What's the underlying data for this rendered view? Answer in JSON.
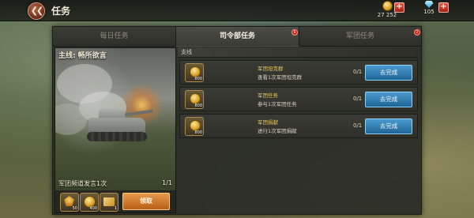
{
  "header": {
    "back_icon": "double-chevron-left-icon",
    "title": "任务",
    "gold": "27 252",
    "gems": "105"
  },
  "tabs": [
    {
      "label": "每日任务",
      "active": false,
      "badge": ""
    },
    {
      "label": "司令部任务",
      "active": true,
      "badge": "1"
    },
    {
      "label": "军团任务",
      "active": false,
      "badge": "2"
    }
  ],
  "mission": {
    "title": "主线: 畅所欲言",
    "description": "军团频道发言1次",
    "progress": "1/1",
    "rewards": [
      {
        "icon": "medal-icon",
        "count": "50"
      },
      {
        "icon": "gold-coin-icon",
        "count": "400"
      },
      {
        "icon": "ticket-icon",
        "count": "1"
      }
    ],
    "claim_label": "领取"
  },
  "branch": {
    "header": "支线",
    "tasks": [
      {
        "name": "军团坦克群",
        "desc": "查看1次军团坦克群",
        "reward": "800",
        "progress": "0/1",
        "button": "去完成"
      },
      {
        "name": "军团任务",
        "desc": "参与1次军团任务",
        "reward": "800",
        "progress": "0/1",
        "button": "去完成"
      },
      {
        "name": "军团捐献",
        "desc": "进行1次军团捐献",
        "reward": "800",
        "progress": "0/1",
        "button": "去完成"
      }
    ]
  },
  "colors": {
    "claim": "#d07a2a",
    "go": "#2f7db6",
    "badge": "#c8281c"
  }
}
